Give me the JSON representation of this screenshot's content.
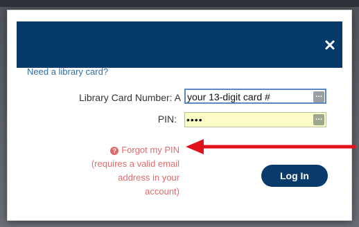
{
  "modal": {
    "need_card_link": "Need a library card?",
    "card_label": "Library Card Number: A",
    "card_value": "your 13-digit card #",
    "pin_label": "PIN:",
    "pin_value": "••••",
    "forgot_link": "Forgot my PIN",
    "forgot_note_1": "(requires a valid email",
    "forgot_note_2": "address in your",
    "forgot_note_3": "account)",
    "login_button": "Log In",
    "close_icon": "close-icon",
    "help_icon": "question-circle-icon"
  },
  "colors": {
    "header_bg": "#063a6a",
    "link": "#2f6fa3",
    "warning": "#e06a6a",
    "arrow": "#e0121b",
    "button_bg": "#083b6b",
    "pin_field_bg": "#fbfcc6"
  }
}
